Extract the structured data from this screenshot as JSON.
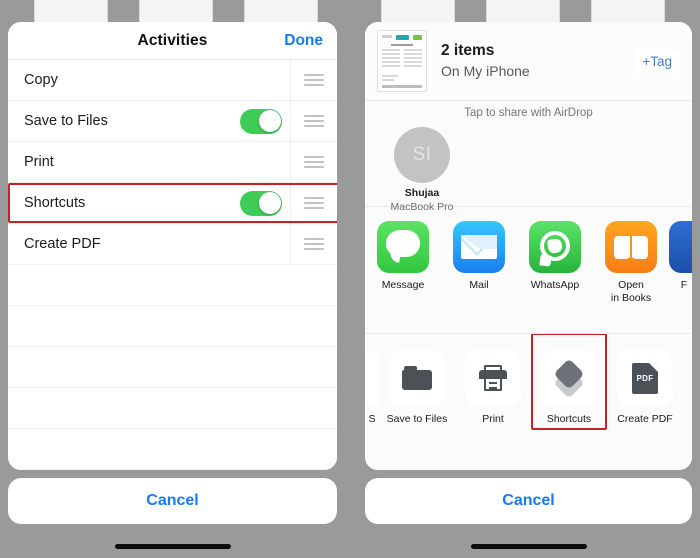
{
  "left_screen": {
    "header": {
      "title": "Activities",
      "done_label": "Done"
    },
    "rows": [
      {
        "label": "Copy",
        "has_toggle": false
      },
      {
        "label": "Save to Files",
        "has_toggle": true,
        "toggle_on": true
      },
      {
        "label": "Print",
        "has_toggle": false
      },
      {
        "label": "Shortcuts",
        "has_toggle": true,
        "toggle_on": true,
        "highlighted": true
      },
      {
        "label": "Create PDF",
        "has_toggle": false
      }
    ],
    "empty_row_count": 5,
    "cancel_label": "Cancel"
  },
  "right_screen": {
    "preview": {
      "items_count_label": "2 items",
      "location_label": "On My iPhone",
      "tag_button_label": "+Tag"
    },
    "airdrop": {
      "hint": "Tap to share with AirDrop",
      "contact_initials": "SI",
      "contact_name": "Shujaa",
      "contact_device": "MacBook Pro"
    },
    "apps": [
      {
        "label": "Message",
        "icon": "messages-app-icon"
      },
      {
        "label": "Mail",
        "icon": "mail-app-icon"
      },
      {
        "label": "WhatsApp",
        "icon": "whatsapp-app-icon"
      },
      {
        "label": "Open\nin Books",
        "label_line1": "Open",
        "label_line2": "in Books",
        "icon": "books-app-icon"
      },
      {
        "label": "F",
        "icon": "facebook-app-icon",
        "partial": true
      }
    ],
    "actions": [
      {
        "label": "S",
        "icon": "partial-action-icon",
        "partial": true
      },
      {
        "label": "Save to Files",
        "icon": "folder-icon"
      },
      {
        "label": "Print",
        "icon": "printer-icon"
      },
      {
        "label": "Shortcuts",
        "icon": "shortcuts-icon",
        "highlighted": true
      },
      {
        "label": "Create PDF",
        "icon": "pdf-file-icon"
      }
    ],
    "cancel_label": "Cancel"
  },
  "colors": {
    "accent_blue": "#1a7aef",
    "toggle_green": "#3fcc56",
    "highlight_red": "#c8202a",
    "backdrop_gray": "#9a9a9a"
  }
}
